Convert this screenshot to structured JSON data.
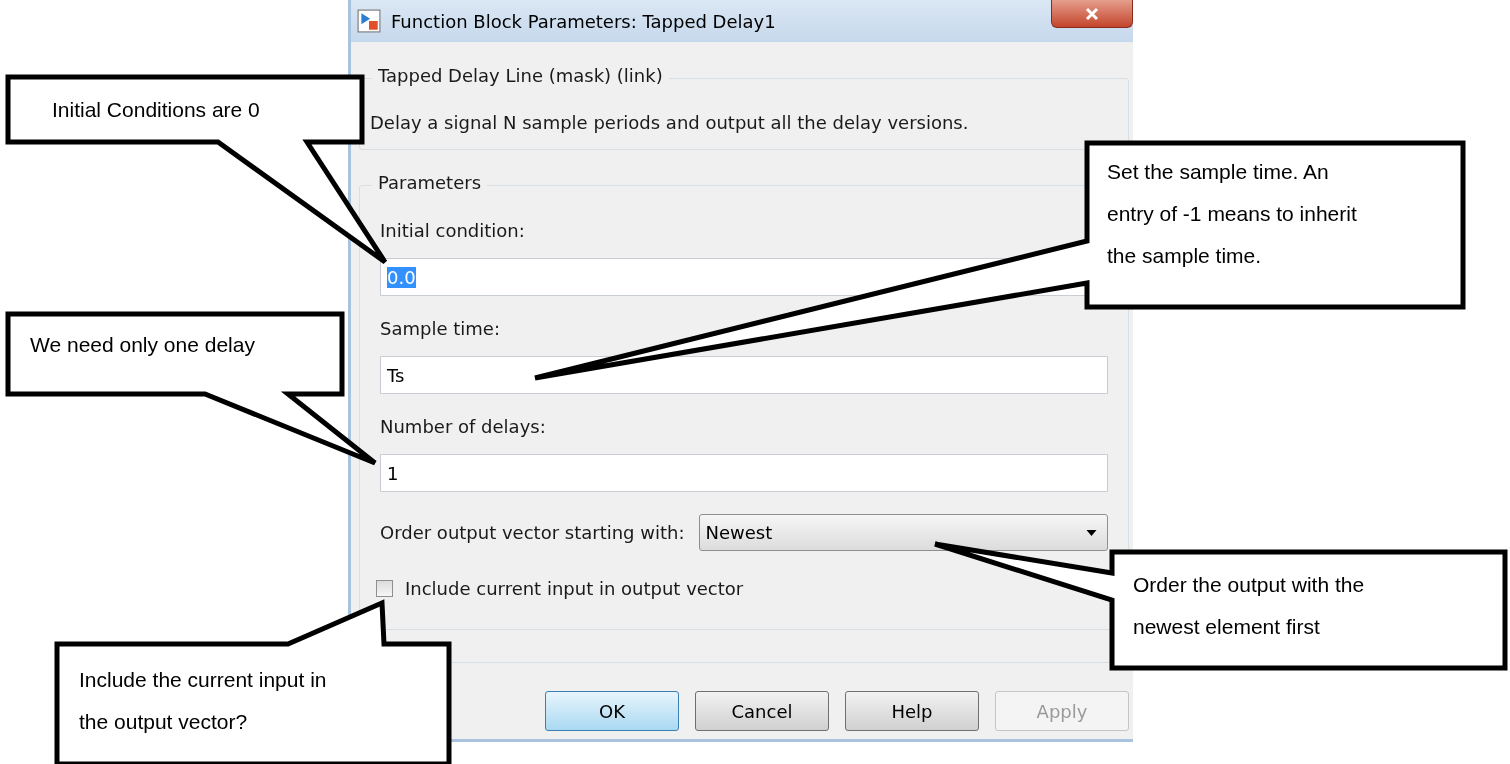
{
  "window": {
    "title": "Function Block Parameters: Tapped Delay1"
  },
  "block": {
    "title": "Tapped Delay Line (mask) (link)",
    "description": "Delay a signal N sample periods and output all the delay versions."
  },
  "parameters": {
    "title": "Parameters",
    "fields": [
      {
        "kind": "text",
        "label": "Initial condition:",
        "value": "0.0",
        "highlighted": true
      },
      {
        "kind": "text",
        "label": "Sample time:",
        "value": "Ts",
        "highlighted": false
      },
      {
        "kind": "text",
        "label": "Number of delays:",
        "value": "1",
        "highlighted": false
      },
      {
        "kind": "dropdown",
        "label": "Order output vector starting with:",
        "value": "Newest",
        "highlighted": false
      },
      {
        "kind": "checkbox",
        "label": "Include current input in output vector",
        "checked": false
      }
    ]
  },
  "buttons": [
    {
      "label": "OK",
      "default": true,
      "disabled": false
    },
    {
      "label": "Cancel",
      "default": false,
      "disabled": false
    },
    {
      "label": "Help",
      "default": false,
      "disabled": false
    },
    {
      "label": "Apply",
      "default": false,
      "disabled": true
    }
  ],
  "callouts": [
    {
      "lines": [
        "Initial Conditions are 0"
      ]
    },
    {
      "lines": [
        "We need only one delay"
      ]
    },
    {
      "lines": [
        "Set the sample time. An",
        "entry of -1 means to inherit",
        "the sample time."
      ]
    },
    {
      "lines": [
        "Order the output with the",
        "newest element first"
      ]
    },
    {
      "lines": [
        "Include the current input in",
        "the output vector?"
      ]
    }
  ]
}
